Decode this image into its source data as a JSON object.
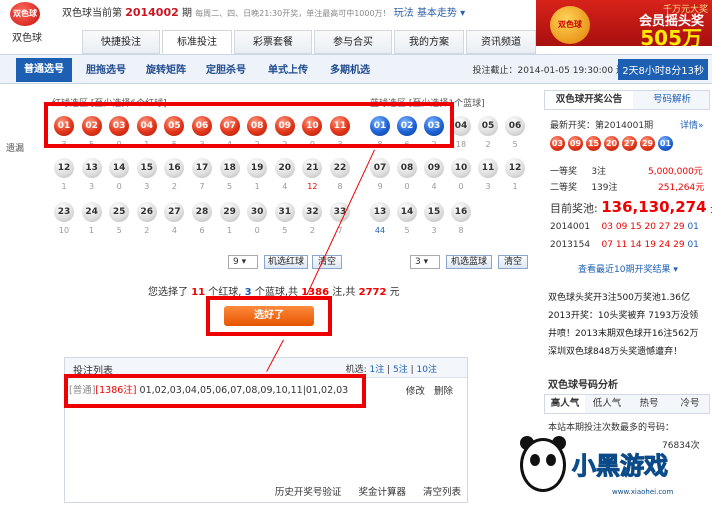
{
  "header": {
    "logo_text": "双色球",
    "logo_badge": "双色球",
    "prefix": "双色球当前第",
    "issue": "2014002",
    "suffix": "期",
    "schedule": "每周二、四、日晚21:30开奖，单注最高可中1000万！",
    "play_link": "玩法",
    "trend_link": "基本走势 ▾"
  },
  "ad": {
    "top": "千万元大奖",
    "mid": "会员摇头奖",
    "big": "505万",
    "ball": "双色球"
  },
  "main_tabs": [
    "快捷投注",
    "标准投注",
    "彩票套餐",
    "参与合买",
    "我的方案",
    "资讯频道"
  ],
  "sub_tabs": [
    "普通选号",
    "胆拖选号",
    "旋转矩阵",
    "定胆杀号",
    "单式上传",
    "多期机选"
  ],
  "deadline": "投注截止：2014-01-05 19:30:00 还剩",
  "countdown": "2天8小时8分13秒",
  "panel": {
    "red_label": "红球选区 [至少选择6个红球]",
    "blue_label": "蓝球选区 [至少选择1个蓝球]",
    "miss_label": "遗漏",
    "red_balls": [
      "01",
      "02",
      "03",
      "04",
      "05",
      "06",
      "07",
      "08",
      "09",
      "10",
      "11",
      "12",
      "13",
      "14",
      "15",
      "16",
      "17",
      "18",
      "19",
      "20",
      "21",
      "22",
      "23",
      "24",
      "25",
      "26",
      "27",
      "28",
      "29",
      "30",
      "31",
      "32",
      "33"
    ],
    "red_miss": [
      "3",
      "5",
      "0",
      "1",
      "5",
      "3",
      "4",
      "2",
      "2",
      "0",
      "3",
      "1",
      "3",
      "0",
      "3",
      "2",
      "7",
      "5",
      "1",
      "4",
      "12",
      "8",
      "10",
      "1",
      "5",
      "2",
      "4",
      "6",
      "1",
      "0",
      "5",
      "2",
      "7"
    ],
    "blue_balls": [
      "01",
      "02",
      "03",
      "04",
      "05",
      "06",
      "07",
      "08",
      "09",
      "10",
      "11",
      "12",
      "13",
      "14",
      "15",
      "16"
    ],
    "blue_miss": [
      "8",
      "6",
      "2",
      "18",
      "2",
      "5",
      "9",
      "0",
      "4",
      "0",
      "3",
      "1",
      "44",
      "5",
      "3",
      "8"
    ],
    "red_count_select": "9",
    "red_random_btn": "机选红球",
    "clear_btn": "清空",
    "blue_count_select": "3",
    "blue_random_btn": "机选蓝球",
    "blue_clear_btn": "清空"
  },
  "summary": {
    "t1": "您选择了",
    "red": "11",
    "t2": "个红球,",
    "blue": "3",
    "t3": "个蓝球,共",
    "bets": "1386",
    "t4": "注,共",
    "amount": "2772",
    "t5": "元"
  },
  "done_btn": "选好了",
  "betlist": {
    "title": "投注列表",
    "machine": "机选:",
    "m1": "1注",
    "m5": "5注",
    "m10": "10注",
    "row_type": "[普通]",
    "row_count": "[1386注]",
    "row_numbers": "01,02,03,04,05,06,07,08,09,10,11|01,02,03",
    "edit": "修改",
    "delete": "删除",
    "foot1": "历史开奖号验证",
    "foot2": "奖金计算器",
    "foot3": "清空列表"
  },
  "side": {
    "tab1": "双色球开奖公告",
    "tab2": "号码解析",
    "latest": "最新开奖：第2014001期",
    "details": "详情»",
    "draw_red": [
      "03",
      "09",
      "15",
      "20",
      "27",
      "29"
    ],
    "draw_blue": "01",
    "p1_name": "一等奖",
    "p1_count": "3注",
    "p1_amount": "5,000,000元",
    "p2_name": "二等奖",
    "p2_count": "139注",
    "p2_amount": "251,264元",
    "pool_label": "目前奖池:",
    "pool_value": "136,130,274",
    "pool_unit": "元",
    "h1_issue": "2014001",
    "h1_nums": "03 09 15 20 27 29",
    "h1_blue": "01",
    "h2_issue": "2013154",
    "h2_nums": "07 11 14 19 24 29",
    "h2_blue": "01",
    "recent_link": "查看最近10期开奖结果 ▾",
    "news": [
      "双色球头奖开3注500万奖池1.36亿",
      "2013开奖：10头奖被弃 7193万没领",
      "井喷！2013末期双色球开16注562万",
      "深圳双色球848万头奖遗憾遭弃！"
    ],
    "analysis_title": "双色球号码分析",
    "a_tabs": [
      "高人气",
      "低人气",
      "热号",
      "冷号"
    ],
    "analysis_desc": "本站本期投注次数最多的号码：",
    "analysis_count": "76834次"
  },
  "watermark": {
    "text": "小黑游戏",
    "url": "www.xiaohei.com"
  }
}
